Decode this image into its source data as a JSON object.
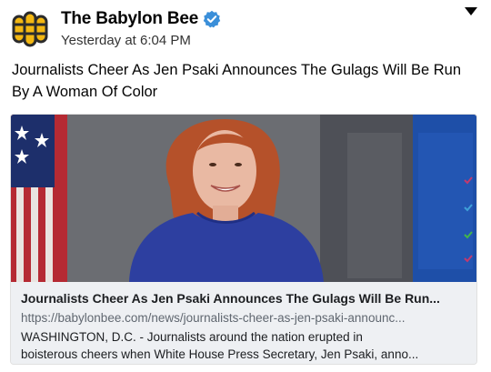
{
  "post": {
    "page_name": "The Babylon Bee",
    "verified_icon": "verified-badge-icon",
    "timestamp": "Yesterday at 6:04 PM",
    "text": "Journalists Cheer As Jen Psaki Announces The Gulags Will Be Run By A Woman Of Color",
    "menu_icon": "caret-down-icon"
  },
  "link": {
    "title": "Journalists Cheer As Jen Psaki Announces The Gulags Will Be Run...",
    "url": "https://babylonbee.com/news/journalists-cheer-as-jen-psaki-announc...",
    "description_line1": "WASHINGTON, D.C. - Journalists around the nation erupted in",
    "description_line2": "boisterous cheers when White House Press Secretary, Jen Psaki, anno..."
  },
  "colors": {
    "verified_blue": "#3b8fd9",
    "logo_yellow": "#f3b712",
    "logo_dark": "#2b2b2b",
    "podium_blue": "#1e4fa8"
  }
}
